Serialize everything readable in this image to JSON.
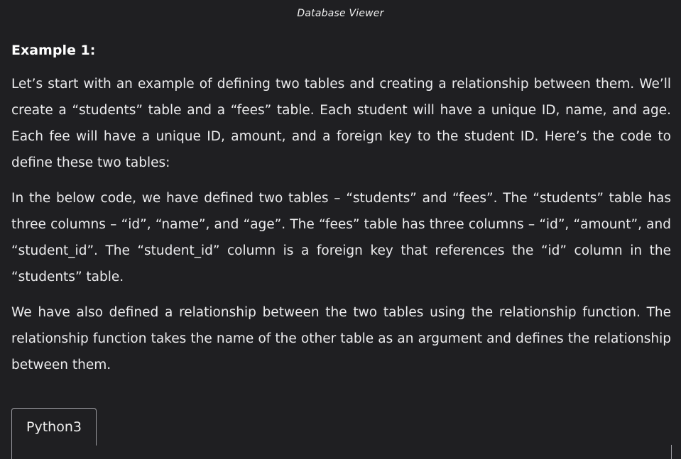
{
  "window": {
    "title": "Database Viewer"
  },
  "article": {
    "heading": "Example 1:",
    "paragraphs": [
      "Let’s start with an example of defining two tables and creating a relationship between them. We’ll create a “students” table and a “fees” table. Each student will have a unique ID, name, and age. Each fee will have a unique ID, amount, and a foreign key to the student ID. Here’s the code to define these two tables:",
      "In the below code, we have defined two tables – “students” and “fees”. The “students” table has three columns – “id”, “name”, and “age”. The “fees” table has three columns – “id”, “amount”, and “student_id”. The “student_id” column is a foreign key that references the “id” column in the “students” table.",
      "We have also defined a relationship between the two tables using the relationship function. The relationship function takes the name of the other table as an argument and defines the relationship between them."
    ]
  },
  "code_block": {
    "tabs": [
      {
        "label": "Python3",
        "active": true
      }
    ]
  }
}
